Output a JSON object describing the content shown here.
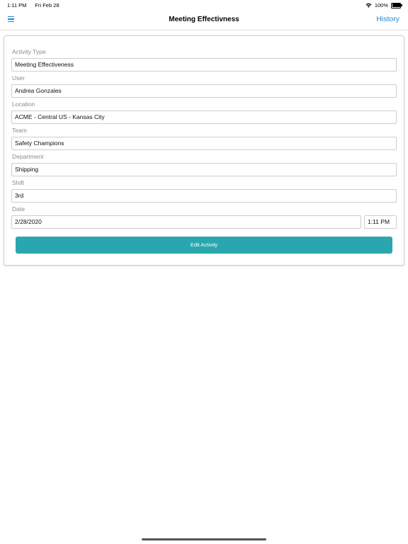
{
  "status_bar": {
    "time": "1:11 PM",
    "date": "Fri Feb 28",
    "battery": "100%"
  },
  "nav": {
    "title": "Meeting Effectivness",
    "history_label": "History"
  },
  "form": {
    "fields": [
      {
        "label": "Activity Type",
        "value": "Meeting Effectiveness"
      },
      {
        "label": "User",
        "value": "Andrea Gonzales"
      },
      {
        "label": "Location",
        "value": "ACME - Central US -  Kansas City"
      },
      {
        "label": "Team",
        "value": "Safety Champions"
      },
      {
        "label": "Department",
        "value": "Shipping"
      },
      {
        "label": "Shift",
        "value": "3rd"
      }
    ],
    "date": {
      "label": "Date",
      "date_value": "2/28/2020",
      "time_value": "1:11 PM"
    },
    "edit_button_label": "Edit Activity"
  },
  "colors": {
    "accent": "#2b85c9",
    "button": "#2aa6ae"
  },
  "icons": {
    "menu": "menu-icon",
    "wifi": "wifi-icon",
    "battery": "battery-icon"
  }
}
